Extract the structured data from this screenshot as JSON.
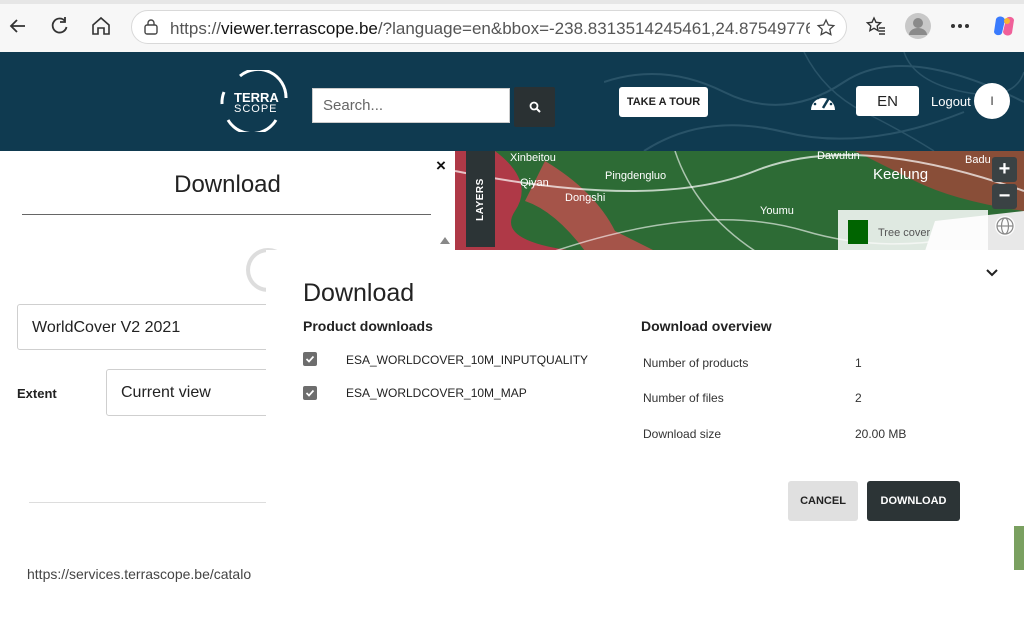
{
  "browser": {
    "url_prefix": "https://",
    "url_host": "viewer.terrascope.be",
    "url_rest": "/?language=en&bbox=-238.8313514245461,24.87549776..."
  },
  "header": {
    "logo_line1": "TERRA",
    "logo_line2": "SCOPE",
    "search_placeholder": "Search...",
    "tour_label": "TAKE A TOUR",
    "language": "EN",
    "logout_label": "Logout",
    "avatar_initial": "I"
  },
  "left_panel": {
    "title": "Download",
    "close_label": "×",
    "product_value": "WorldCover V2 2021",
    "extent_label": "Extent",
    "extent_value": "Current view",
    "catalog_url": "https://services.terrascope.be/catalo"
  },
  "map": {
    "layers_tab": "LAYERS",
    "zoom_in": "+",
    "zoom_out": "−",
    "legend_label": "Tree cover",
    "legend_color": "#006400",
    "place_labels": [
      "Xinbeitou",
      "Qiyan",
      "Dongshi",
      "Pingdengluo",
      "Keelung",
      "Dawulun",
      "Youmu",
      "Badu"
    ]
  },
  "modal": {
    "title": "Download",
    "product_downloads_heading": "Product downloads",
    "overview_heading": "Download overview",
    "files": [
      {
        "label": "ESA_WORLDCOVER_10M_INPUTQUALITY",
        "checked": true
      },
      {
        "label": "ESA_WORLDCOVER_10M_MAP",
        "checked": true
      }
    ],
    "overview": [
      {
        "key": "Number of products",
        "value": "1"
      },
      {
        "key": "Number of files",
        "value": "2"
      },
      {
        "key": "Download size",
        "value": "20.00 MB"
      }
    ],
    "cancel_label": "CANCEL",
    "download_label": "DOWNLOAD"
  },
  "colors": {
    "header_bg": "#0f3a50",
    "dark_button": "#2c3436",
    "cancel_bg": "#e0e0e0"
  }
}
